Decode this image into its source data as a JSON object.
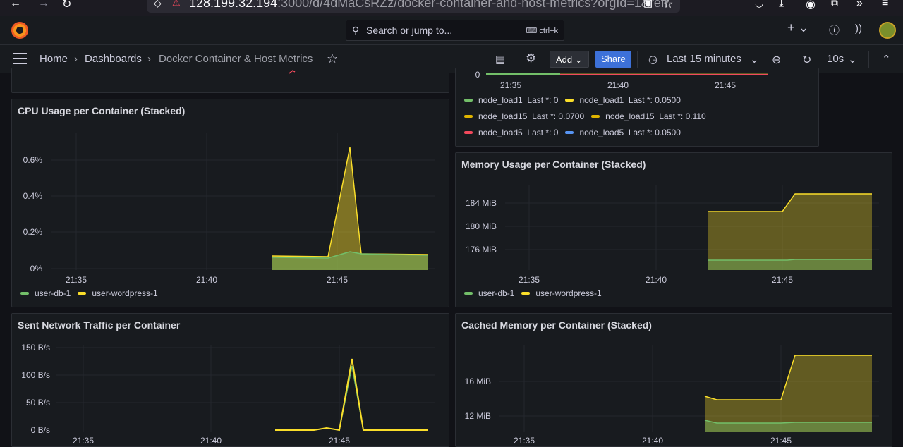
{
  "browser": {
    "url_host": "128.199.32.194",
    "url_rest": ":3000/d/4dMaCsRZz/docker-container-and-host-metrics?orgId=1&refr"
  },
  "topnav": {
    "search_placeholder": "Search or jump to...",
    "search_shortcut": "ctrl+k",
    "plus_label": "+",
    "help_icon": "help-icon",
    "news_icon": "rss-icon"
  },
  "breadcrumb": {
    "home": "Home",
    "dashboards": "Dashboards",
    "current": "Docker Container & Host Metrics"
  },
  "toolbar": {
    "add_label": "Add",
    "share_label": "Share",
    "time_range": "Last 15 minutes",
    "refresh_interval": "10s"
  },
  "colors": {
    "green": "#73bf69",
    "yellow": "#fade2a",
    "orange_yellow": "#e0b400",
    "red": "#f2495c",
    "blue": "#5794f2"
  },
  "load_panel": {
    "y_zero": "0",
    "x_ticks": [
      "21:35",
      "21:40",
      "21:45"
    ],
    "legend": [
      {
        "name": "node_load1",
        "stat": "Last *: 0",
        "color": "#73bf69"
      },
      {
        "name": "node_load1",
        "stat": "Last *: 0.0500",
        "color": "#fade2a"
      },
      {
        "name": "node_load15",
        "stat": "Last *: 0.0700",
        "color": "#e0b400"
      },
      {
        "name": "node_load15",
        "stat": "Last *: 0.110",
        "color": "#e0b400"
      },
      {
        "name": "node_load5",
        "stat": "Last *: 0",
        "color": "#f2495c"
      },
      {
        "name": "node_load5",
        "stat": "Last *: 0.0500",
        "color": "#5794f2"
      }
    ]
  },
  "chart_data": [
    {
      "type": "area",
      "title": "CPU Usage per Container (Stacked)",
      "y_ticks": [
        "0%",
        "0.2%",
        "0.4%",
        "0.6%"
      ],
      "x_ticks": [
        "21:35",
        "21:40",
        "21:45"
      ],
      "ylim": [
        0,
        0.7
      ],
      "series": [
        {
          "name": "user-db-1",
          "color": "#73bf69",
          "x": [
            "21:42:30",
            "21:44:15",
            "21:45:00",
            "21:45:30",
            "21:46:00",
            "21:48:30"
          ],
          "values": [
            0.07,
            0.07,
            0.1,
            0.09,
            0.09,
            0.09
          ]
        },
        {
          "name": "user-wordpress-1",
          "color": "#fade2a",
          "x": [
            "21:42:30",
            "21:44:15",
            "21:45:00",
            "21:45:30",
            "21:46:00",
            "21:48:30"
          ],
          "values": [
            0.08,
            0.08,
            0.68,
            0.09,
            0.09,
            0.09
          ]
        }
      ]
    },
    {
      "type": "area",
      "title": "Memory Usage per Container (Stacked)",
      "y_ticks": [
        "176 MiB",
        "180 MiB",
        "184 MiB"
      ],
      "x_ticks": [
        "21:35",
        "21:40",
        "21:45"
      ],
      "series": [
        {
          "name": "user-db-1",
          "color": "#73bf69"
        },
        {
          "name": "user-wordpress-1",
          "color": "#fade2a",
          "x": [
            "21:42:00",
            "21:45:00",
            "21:45:30",
            "21:48:30"
          ],
          "values": [
            184.1,
            184.1,
            186.2,
            186.2
          ]
        }
      ]
    },
    {
      "type": "line",
      "title": "Sent Network Traffic per Container",
      "y_ticks": [
        "0 B/s",
        "50 B/s",
        "100 B/s",
        "150 B/s"
      ],
      "x_ticks": [
        "21:35",
        "21:40",
        "21:45"
      ],
      "ylim": [
        0,
        150
      ],
      "series": [
        {
          "name": "user-db-1",
          "color": "#73bf69",
          "x": [
            "21:42:30",
            "21:44:15",
            "21:45:00",
            "21:45:30",
            "21:48:30"
          ],
          "values": [
            0,
            0,
            118,
            0,
            0
          ]
        },
        {
          "name": "user-wordpress-1",
          "color": "#fade2a",
          "x": [
            "21:42:30",
            "21:44:00",
            "21:44:30",
            "21:45:00",
            "21:45:30",
            "21:48:30"
          ],
          "values": [
            0,
            4,
            0,
            130,
            0,
            0
          ]
        }
      ]
    },
    {
      "type": "area",
      "title": "Cached Memory per Container (Stacked)",
      "y_ticks": [
        "12 MiB",
        "16 MiB"
      ],
      "x_ticks": [
        "21:35",
        "21:40",
        "21:45"
      ],
      "series": [
        {
          "name": "user-db-1",
          "color": "#73bf69"
        },
        {
          "name": "user-wordpress-1",
          "color": "#fade2a",
          "x": [
            "21:42:00",
            "21:42:30",
            "21:45:00",
            "21:45:30",
            "21:48:30"
          ],
          "values": [
            14.2,
            13.9,
            13.9,
            19.0,
            19.0
          ]
        }
      ]
    }
  ],
  "legend_labels": {
    "db": "user-db-1",
    "wp": "user-wordpress-1"
  }
}
